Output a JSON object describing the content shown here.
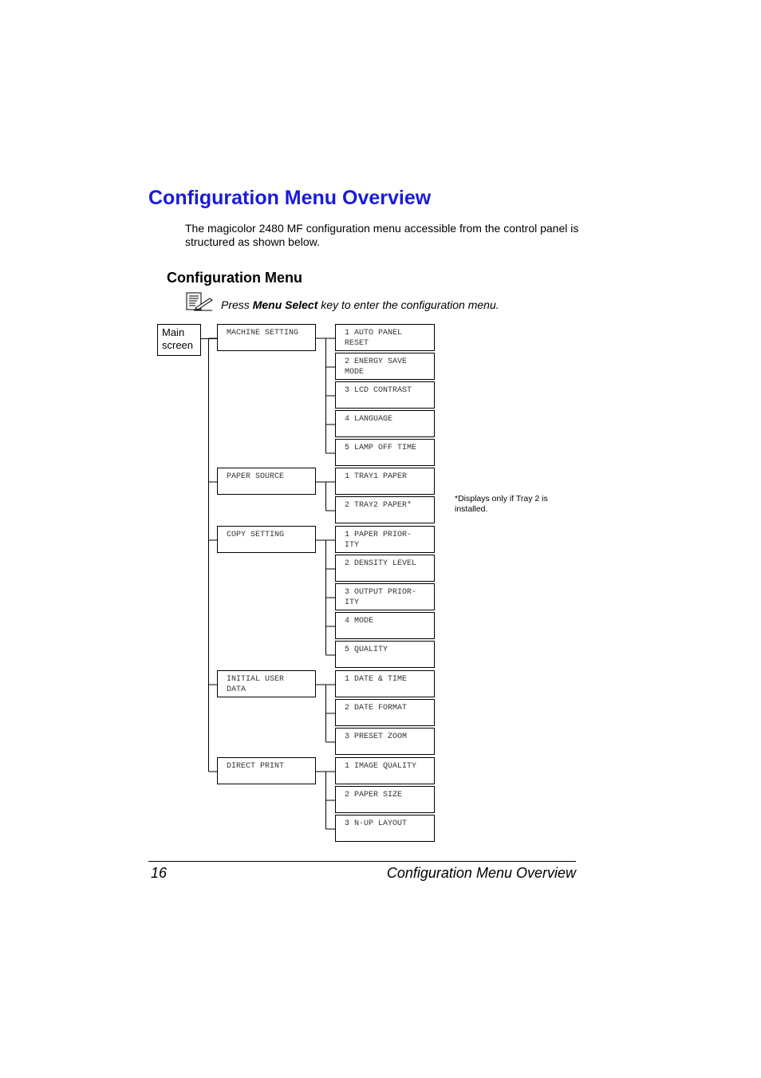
{
  "title": "Configuration Menu Overview",
  "intro": "The magicolor 2480 MF configuration menu accessible from the control panel is structured as shown below.",
  "subheading": "Configuration Menu",
  "note": {
    "icon": "note-pencil-icon",
    "pre": "Press ",
    "bold": "Menu Select",
    "post": " key to enter the configuration menu."
  },
  "footnote": "*Displays only if Tray 2 is installed.",
  "colors": {
    "title": "#1a1adc"
  },
  "menu": {
    "root": "Main\nscreen",
    "categories": [
      {
        "label": "MACHINE SETTING",
        "items": [
          "1 AUTO PANEL\nRESET",
          "2 ENERGY SAVE\nMODE",
          "3 LCD CONTRAST",
          "4 LANGUAGE",
          "5 LAMP OFF TIME"
        ]
      },
      {
        "label": "PAPER SOURCE",
        "items": [
          "1 TRAY1 PAPER",
          "2 TRAY2 PAPER*"
        ]
      },
      {
        "label": "COPY SETTING",
        "items": [
          "1 PAPER PRIOR-\nITY",
          "2 DENSITY LEVEL",
          "3 OUTPUT PRIOR-\nITY",
          "4 MODE",
          "5 QUALITY"
        ]
      },
      {
        "label": "INITIAL USER\nDATA",
        "items": [
          "1 DATE & TIME",
          "2 DATE FORMAT",
          "3 PRESET ZOOM"
        ]
      },
      {
        "label": "DIRECT PRINT",
        "items": [
          "1 IMAGE QUALITY",
          "2 PAPER SIZE",
          "3 N-UP LAYOUT"
        ]
      }
    ]
  },
  "footer": {
    "page": "16",
    "title": "Configuration Menu Overview"
  }
}
